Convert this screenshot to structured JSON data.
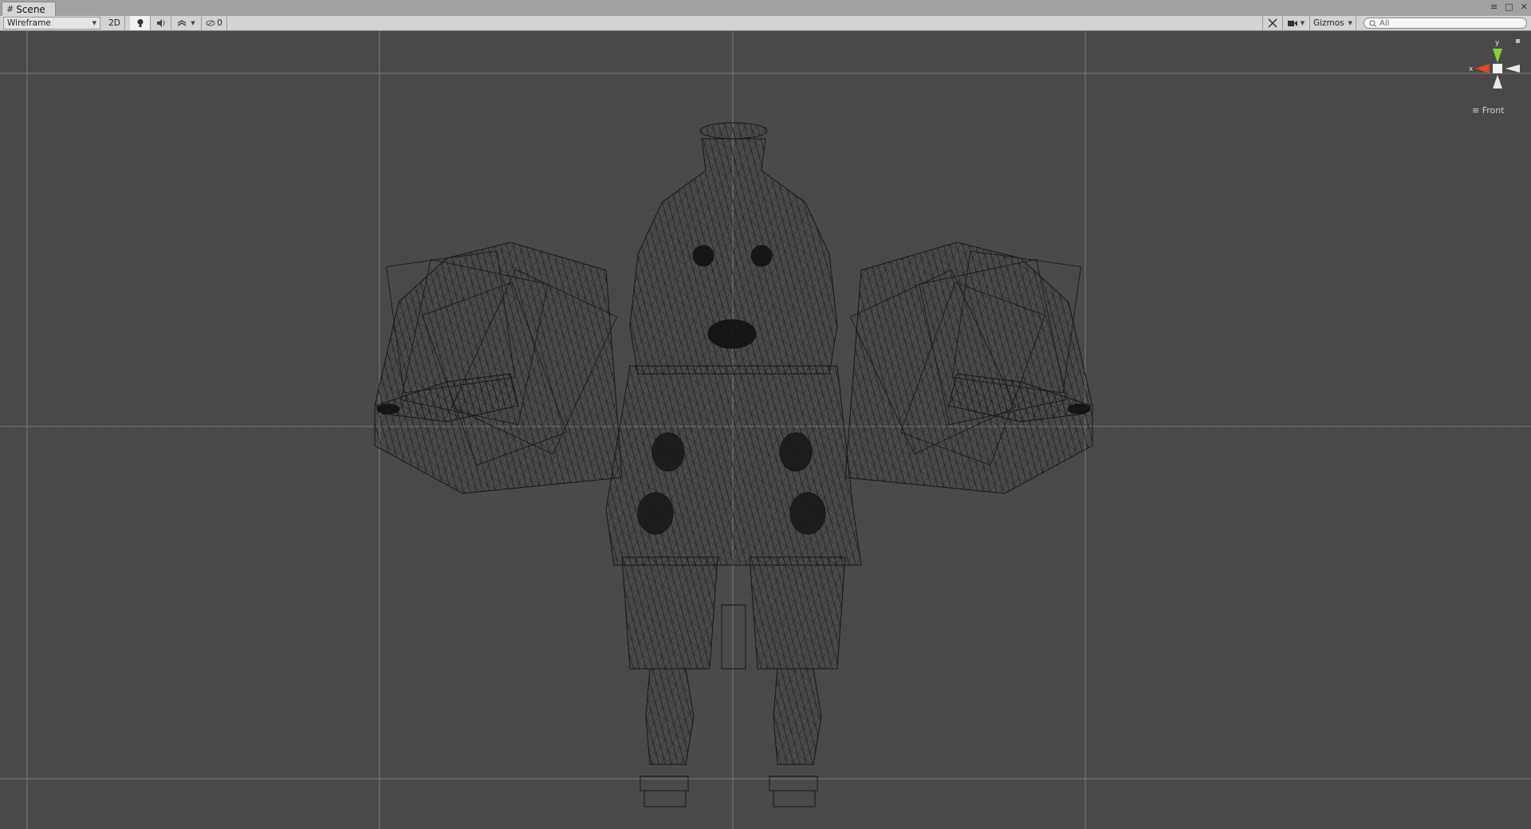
{
  "window": {
    "tab_title": "Scene",
    "tab_icon": "hash-icon",
    "controls": [
      "≡",
      "□",
      "✕"
    ]
  },
  "toolbar": {
    "draw_mode": "Wireframe",
    "mode_2d": "2D",
    "lighting_icon": "lightbulb-icon",
    "audio_icon": "speaker-icon",
    "effects_icon": "effects-icon",
    "hidden_count": "0",
    "tools_icon": "tools-icon",
    "camera_icon": "camera-icon",
    "gizmos_label": "Gizmos",
    "search_placeholder": "All"
  },
  "scene": {
    "view_label": "Front",
    "axes": {
      "y": "y",
      "x": "x"
    },
    "axis_colors": {
      "x": "#e0462c",
      "y": "#8ad02c",
      "z": "#ffffff"
    },
    "background_color": "#494949",
    "wireframe_color": "#111111"
  }
}
